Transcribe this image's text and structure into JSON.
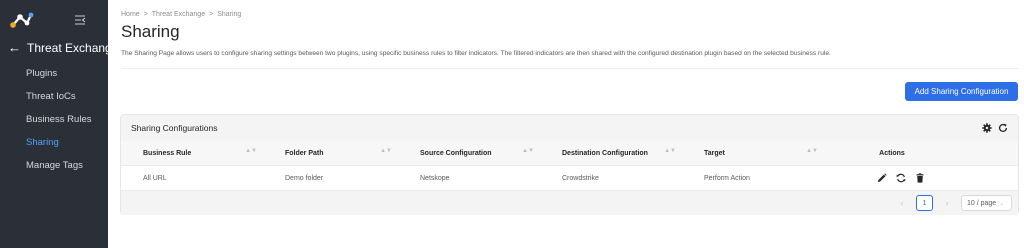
{
  "colors": {
    "sidebar_bg": "#2b3038",
    "accent": "#2e6ee6",
    "active_nav": "#4fa3f7"
  },
  "sidebar": {
    "logo_icon": "netskope-logo",
    "collapse_icon": "menu-fold-icon",
    "back_icon": "arrow-left-icon",
    "section_title": "Threat Exchange",
    "items": [
      {
        "label": "Plugins",
        "active": false
      },
      {
        "label": "Threat IoCs",
        "active": false
      },
      {
        "label": "Business Rules",
        "active": false
      },
      {
        "label": "Sharing",
        "active": true
      },
      {
        "label": "Manage Tags",
        "active": false
      }
    ]
  },
  "breadcrumb": {
    "items": [
      "Home",
      "Threat Exchange",
      "Sharing"
    ],
    "separator": ">"
  },
  "page": {
    "title": "Sharing",
    "description": "The Sharing Page allows users to configure sharing settings between two plugins, using specific business rules to filter indicators. The filtered indicators are then shared with the configured destination plugin based on the selected business rule."
  },
  "toolbar": {
    "add_label": "Add Sharing Configuration"
  },
  "panel": {
    "title": "Sharing Configurations",
    "settings_icon": "gear-icon",
    "refresh_icon": "reload-icon"
  },
  "table": {
    "columns": [
      "Business Rule",
      "Folder Path",
      "Source Configuration",
      "Destination Configuration",
      "Target",
      "Actions"
    ],
    "rows": [
      {
        "business_rule": "All URL",
        "folder_path": "Demo folder",
        "source": "Netskope",
        "destination": "Crowdstrike",
        "target": "Perform Action",
        "actions": [
          "edit-icon",
          "sync-icon",
          "delete-icon"
        ]
      }
    ]
  },
  "pagination": {
    "current_page": "1",
    "page_size": "10 / page"
  }
}
